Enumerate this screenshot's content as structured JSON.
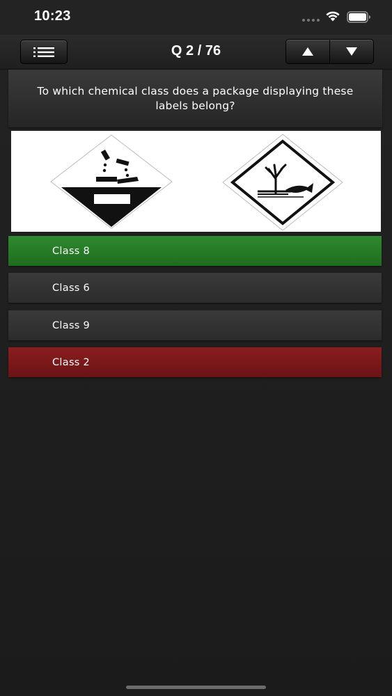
{
  "status_bar": {
    "time": "10:23",
    "icons": [
      "signal-dots-icon",
      "wifi-icon",
      "battery-icon"
    ]
  },
  "nav": {
    "menu_icon": "list-icon",
    "title": "Q 2 / 76",
    "prev_icon": "arrow-up-icon",
    "next_icon": "arrow-down-icon"
  },
  "question": {
    "text": "To which chemical class does a package displaying these labels belong?"
  },
  "image": {
    "labels": [
      "corrosive-hazard-icon",
      "environmental-hazard-icon"
    ]
  },
  "answers": [
    {
      "label": "Class 8",
      "state": "correct"
    },
    {
      "label": "Class 6",
      "state": "neutral"
    },
    {
      "label": "Class 9",
      "state": "neutral"
    },
    {
      "label": "Class 2",
      "state": "wrong"
    }
  ],
  "colors": {
    "correct": "#268026",
    "wrong": "#7d191b",
    "neutral": "#333333",
    "background": "#1f1f1f"
  }
}
